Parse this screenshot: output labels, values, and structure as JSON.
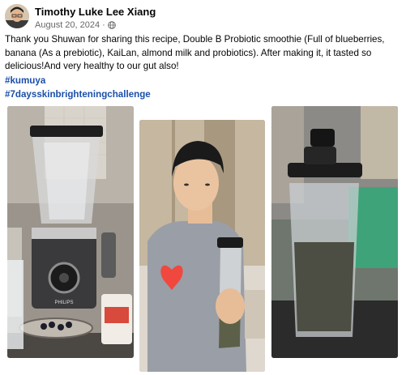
{
  "post": {
    "author": "Timothy Luke Lee Xiang",
    "date": "August 20, 2024 ·",
    "audience_icon": "globe-icon",
    "text": "Thank you Shuwan for sharing this recipe, Double B Probiotic smoothie (Full of blueberries, banana (As a prebiotic), KaiLan, almond milk and probiotics). After making it, it tasted so delicious!And very healthy to our gut also!",
    "hashtags": [
      "#kumuya",
      "#7daysskinbrighteningchallenge"
    ]
  },
  "photos": [
    {
      "name": "blender-photo",
      "brand_text": "PHILIPS"
    },
    {
      "name": "man-holding-bottle-photo"
    },
    {
      "name": "smoothie-bottle-photo"
    }
  ],
  "colors": {
    "hashtag": "#1b4fa8",
    "meta": "#65676b",
    "heart": "#f0483e"
  }
}
